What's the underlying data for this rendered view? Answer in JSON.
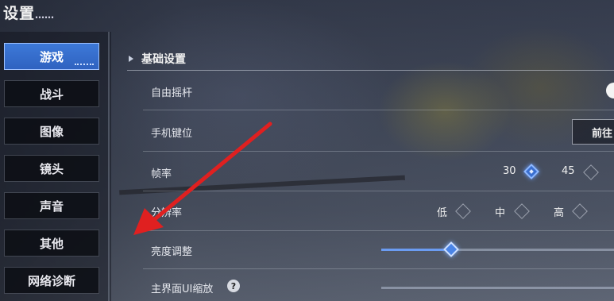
{
  "header": {
    "title": "设置",
    "title_suffix": "……"
  },
  "sidebar": {
    "items": [
      {
        "label": "游戏",
        "active": true
      },
      {
        "label": "战斗"
      },
      {
        "label": "图像"
      },
      {
        "label": "镜头"
      },
      {
        "label": "声音"
      },
      {
        "label": "其他"
      },
      {
        "label": "网络诊断"
      }
    ]
  },
  "main": {
    "section_title": "基础设置",
    "rows": {
      "free_joystick": {
        "label": "自由摇杆",
        "value": "on"
      },
      "phone_keys": {
        "label": "手机键位",
        "button": "前往"
      },
      "frame_rate": {
        "label": "帧率",
        "options": [
          "30",
          "45"
        ],
        "selected": "30"
      },
      "resolution": {
        "label": "分辨率",
        "options": [
          "低",
          "中",
          "高"
        ],
        "extra_char": "… (cut off)"
      },
      "brightness": {
        "label": "亮度调整",
        "level": 0.3
      },
      "ui_scale": {
        "label": "主界面UI缩放",
        "help_icon": "question-icon"
      }
    }
  },
  "annotation": {
    "color": "#e02020",
    "icon": "red-arrow"
  },
  "colors": {
    "accent": "#3a6fd0",
    "accent_light": "#8fb8ff"
  }
}
